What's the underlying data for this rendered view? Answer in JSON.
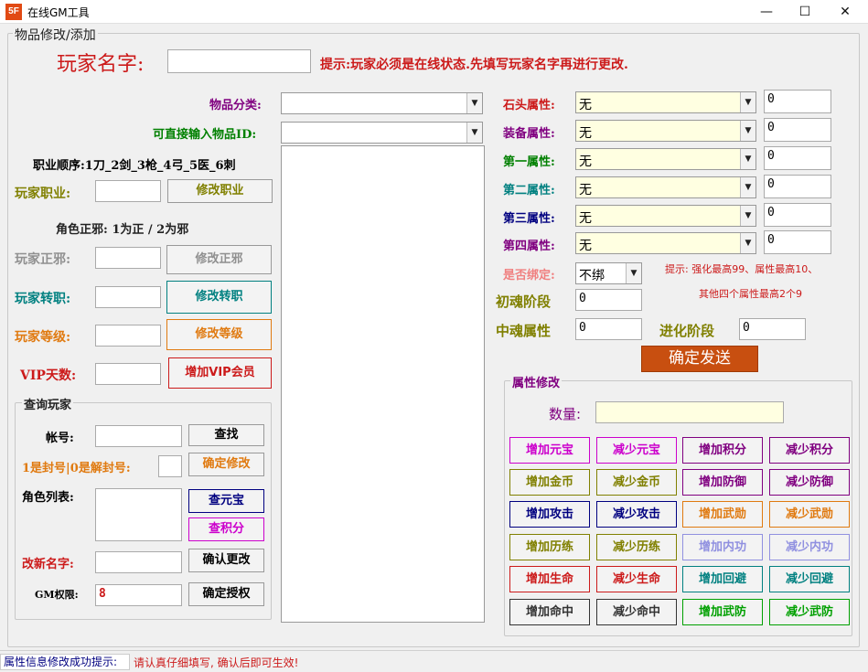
{
  "window": {
    "icon_text": "5F",
    "title": "在线GM工具",
    "minimize": "—",
    "maximize": "☐",
    "close": "✕"
  },
  "group_item": {
    "label": "物品修改/添加"
  },
  "player": {
    "name_label": "玩家名字:",
    "name_value": "",
    "hint": "提示:玩家必须是在线状态.先填写玩家名字再进行更改."
  },
  "items": {
    "category_label": "物品分类:",
    "category_value": "",
    "id_label": "可直接输入物品ID:",
    "id_value": ""
  },
  "job": {
    "order_text": "职业顺序:1刀_2剑_3枪_4弓_5医_6刺",
    "label": "玩家职业:",
    "value": "",
    "button": "修改职业"
  },
  "align": {
    "note": "角色正邪: 1为正 / 2为邪",
    "label": "玩家正邪:",
    "value": "",
    "button": "修改正邪"
  },
  "transfer": {
    "label": "玩家转职:",
    "value": "",
    "button": "修改转职"
  },
  "level": {
    "label": "玩家等级:",
    "value": "",
    "button": "修改等级"
  },
  "vip": {
    "label": "VIP天数:",
    "value": "",
    "button": "增加VIP会员"
  },
  "query": {
    "group_label": "查询玩家",
    "account_label": "帐号:",
    "account_value": "",
    "find_button": "查找",
    "ban_label": "1是封号|0是解封号:",
    "ban_value": "",
    "confirm_button": "确定修改",
    "role_list_label": "角色列表:",
    "check_yuanbao": "查元宝",
    "check_points": "查积分",
    "rename_label": "改新名字:",
    "rename_value": "",
    "rename_button": "确认更改",
    "gm_label": "GM权限:",
    "gm_value": "8",
    "gm_button": "确定授权"
  },
  "attrs": {
    "stone_label": "石头属性:",
    "stone_value": "无",
    "stone_num": "0",
    "equip_label": "装备属性:",
    "equip_value": "无",
    "equip_num": "0",
    "first_label": "第一属性:",
    "first_value": "无",
    "first_num": "0",
    "second_label": "第二属性:",
    "second_value": "无",
    "second_num": "0",
    "third_label": "第三属性:",
    "third_value": "无",
    "third_num": "0",
    "fourth_label": "第四属性:",
    "fourth_value": "无",
    "fourth_num": "0",
    "bind_label": "是否绑定:",
    "bind_value": "不绑",
    "hint1": "提示: 强化最高99、属性最高10、",
    "hint2": "其他四个属性最高2个9",
    "soul1_label": "初魂阶段",
    "soul1_value": "0",
    "soul2_label": "中魂属性",
    "soul2_value": "0",
    "evolve_label": "进化阶段",
    "evolve_value": "0",
    "send_button": "确定发送"
  },
  "prop": {
    "group_label": "属性修改",
    "qty_label": "数量:",
    "qty_value": "",
    "buttons": [
      "增加元宝",
      "减少元宝",
      "增加积分",
      "减少积分",
      "增加金币",
      "减少金币",
      "增加防御",
      "减少防御",
      "增加攻击",
      "减少攻击",
      "增加武勋",
      "减少武勋",
      "增加历练",
      "减少历练",
      "增加内功",
      "减少内功",
      "增加生命",
      "减少生命",
      "增加回避",
      "减少回避",
      "增加命中",
      "减少命中",
      "增加武防",
      "减少武防"
    ]
  },
  "status": {
    "label": "属性信息修改成功提示:",
    "message": "请认真仔细填写, 确认后即可生效!"
  },
  "colors": {
    "accent_red": "#cc1a1a",
    "send_button": "#c84f10",
    "purple": "#800080",
    "green": "#008000",
    "teal": "#008080",
    "navy": "#000080",
    "orange": "#e07a10"
  }
}
